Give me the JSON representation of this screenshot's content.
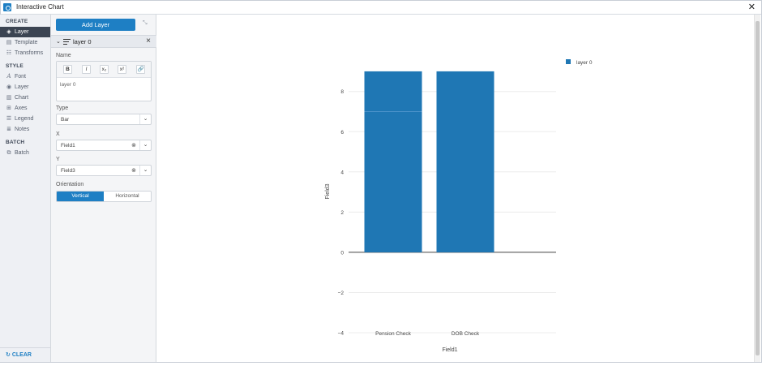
{
  "window": {
    "title": "Interactive Chart",
    "close_glyph": "✕"
  },
  "nav": {
    "create_label": "CREATE",
    "create_items": [
      {
        "label": "Layer",
        "icon": "layers-icon"
      },
      {
        "label": "Template",
        "icon": "template-icon"
      },
      {
        "label": "Transforms",
        "icon": "transforms-icon"
      }
    ],
    "style_label": "STYLE",
    "style_items": [
      {
        "label": "Font",
        "icon": "font-icon"
      },
      {
        "label": "Layer",
        "icon": "eye-icon"
      },
      {
        "label": "Chart",
        "icon": "bar-chart-icon"
      },
      {
        "label": "Axes",
        "icon": "grid-icon"
      },
      {
        "label": "Legend",
        "icon": "legend-icon"
      },
      {
        "label": "Notes",
        "icon": "notes-icon"
      }
    ],
    "batch_label": "BATCH",
    "batch_items": [
      {
        "label": "Batch",
        "icon": "batch-icon"
      }
    ],
    "clear_label": "CLEAR"
  },
  "panel": {
    "add_layer_label": "Add Layer",
    "layer_name": "layer 0",
    "name_label": "Name",
    "editor_buttons": [
      "B",
      "I",
      "x₂",
      "x²",
      "🔗"
    ],
    "name_value": "layer 0",
    "type_label": "Type",
    "type_value": "Bar",
    "x_label": "X",
    "x_value": "Field1",
    "y_label": "Y",
    "y_value": "Field3",
    "orientation_label": "Orientation",
    "orientation_options": [
      "Vertical",
      "Horizontal"
    ],
    "orientation_selected": "Vertical"
  },
  "chart_data": {
    "type": "bar",
    "categories": [
      "Pension Check",
      "DOB Check"
    ],
    "series": [
      {
        "name": "layer 0",
        "values": [
          9,
          9
        ],
        "color": "#1f77b4"
      }
    ],
    "inner_divider_at": [
      7,
      null
    ],
    "xlabel": "Field1",
    "ylabel": "Field3",
    "ylim": [
      -4.2,
      9.4
    ],
    "yticks": [
      -4,
      -2,
      0,
      2,
      4,
      6,
      8
    ],
    "ytick_labels": [
      "−4",
      "−2",
      "0",
      "2",
      "4",
      "6",
      "8"
    ],
    "grid": true,
    "legend": "top-right"
  }
}
